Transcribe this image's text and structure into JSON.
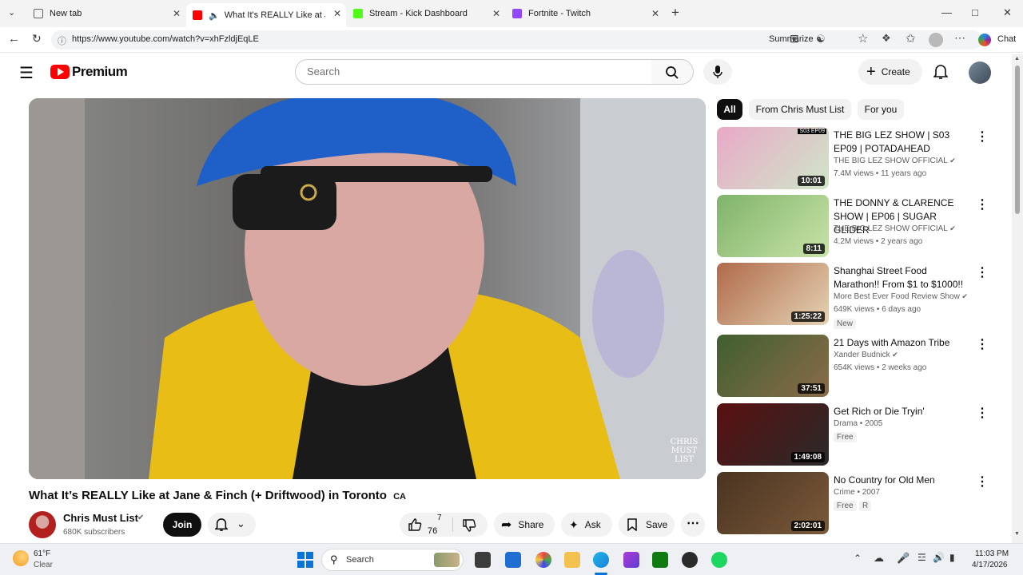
{
  "browser": {
    "tabs": [
      {
        "label": "New tab",
        "color": "#5f6368"
      },
      {
        "label": "What It's REALLY Like at Jane",
        "color": "#ff0000"
      },
      {
        "label": "Stream - Kick Dashboard",
        "color": "#53fc18"
      },
      {
        "label": "Fortnite - Twitch",
        "color": "#9146ff"
      }
    ],
    "new_tab_icon": "+",
    "url": "https://www.youtube.com/watch?v=xhFzldjEqLE",
    "summarize_label": "Summarize",
    "chat_label": "Chat"
  },
  "youtube": {
    "logo_text": "Premium",
    "search_placeholder": "Search",
    "create_label": "Create",
    "filters": [
      "All",
      "From Chris Must List",
      "For you"
    ]
  },
  "video": {
    "title": "What It’s REALLY Like at Jane & Finch (+ Driftwood) in Toronto",
    "flag": "CA",
    "watermark": "CHRIS MUST LIST",
    "channel": "Chris Must List",
    "subscribers": "680K subscribers",
    "join_label": "Join",
    "likes_top": "7",
    "likes_bottom": "76",
    "share_label": "Share",
    "ask_label": "Ask",
    "save_label": "Save"
  },
  "recommendations": [
    {
      "title": "THE BIG LEZ SHOW | S03 EP09 | POTADAHEAD",
      "channel": "THE BIG LEZ SHOW OFFICIAL",
      "verified": true,
      "stats": "7.4M views • 11 years ago",
      "duration": "10:01",
      "thumb_label": "S03 EP09",
      "badges": [],
      "colors": [
        "#e9a9c8",
        "#cfe6c8"
      ]
    },
    {
      "title": "THE DONNY & CLARENCE SHOW | EP06 | SUGAR GLIDER",
      "channel": "THE BIG LEZ SHOW OFFICIAL",
      "verified": true,
      "stats": "4.2M views • 2 years ago",
      "duration": "8:11",
      "thumb_label": "",
      "badges": [],
      "colors": [
        "#7fb36a",
        "#c9e3a8"
      ]
    },
    {
      "title": "Shanghai Street Food Marathon!! From $1 to $1000!!",
      "channel": "More Best Ever Food Review Show",
      "verified": true,
      "stats": "649K views • 6 days ago",
      "duration": "1:25:22",
      "thumb_label": "",
      "badges": [
        "New"
      ],
      "colors": [
        "#b06a4a",
        "#e4d3b4"
      ]
    },
    {
      "title": "21 Days with Amazon Tribe",
      "channel": "Xander Budnick",
      "verified": true,
      "stats": "654K views • 2 weeks ago",
      "duration": "37:51",
      "thumb_label": "",
      "badges": [],
      "colors": [
        "#3f5f2f",
        "#8b6b4a"
      ]
    },
    {
      "title": "Get Rich or Die Tryin'",
      "channel": "Drama • 2005",
      "verified": false,
      "stats": "",
      "duration": "1:49:08",
      "thumb_label": "",
      "badges": [
        "Free"
      ],
      "colors": [
        "#5a1010",
        "#2a2a2a"
      ]
    },
    {
      "title": "No Country for Old Men",
      "channel": "Crime • 2007",
      "verified": false,
      "stats": "",
      "duration": "2:02:01",
      "thumb_label": "",
      "badges": [
        "Free",
        "R"
      ],
      "colors": [
        "#4a3320",
        "#7a5a3a"
      ]
    }
  ],
  "taskbar": {
    "weather_temp": "61°F",
    "weather_desc": "Clear",
    "search_label": "Search",
    "time": "11:03 PM",
    "date": "4/17/2026"
  }
}
